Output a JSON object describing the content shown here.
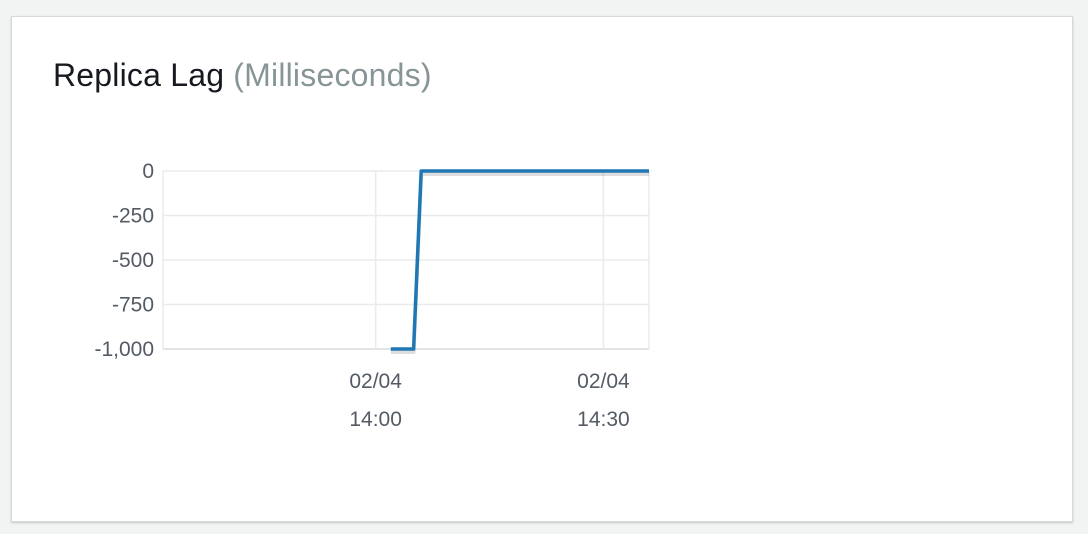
{
  "widget": {
    "title": "Replica Lag",
    "unit": "(Milliseconds)"
  },
  "colors": {
    "line": "#1f77b4",
    "grid": "#e9ebed",
    "axis": "#d5dbdb"
  },
  "chart_data": {
    "type": "line",
    "title": "Replica Lag (Milliseconds)",
    "xlabel": "",
    "ylabel": "",
    "ylim": [
      -1000,
      0
    ],
    "xlim": [
      "02/04 13:32",
      "02/04 14:36"
    ],
    "y_ticks": [
      0,
      -250,
      -500,
      -750,
      -1000
    ],
    "y_tick_labels": [
      "0",
      "-250",
      "-500",
      "-750",
      "-1,000"
    ],
    "x_ticks": [
      "02/04 14:00",
      "02/04 14:30"
    ],
    "x_tick_labels": [
      [
        "02/04",
        "14:00"
      ],
      [
        "02/04",
        "14:30"
      ]
    ],
    "grid": true,
    "legend": "none",
    "series": [
      {
        "x": [
          "02/04 14:02",
          "02/04 14:05",
          "02/04 14:06",
          "02/04 14:36"
        ],
        "y": [
          -1000,
          -1000,
          0,
          0
        ]
      }
    ]
  }
}
